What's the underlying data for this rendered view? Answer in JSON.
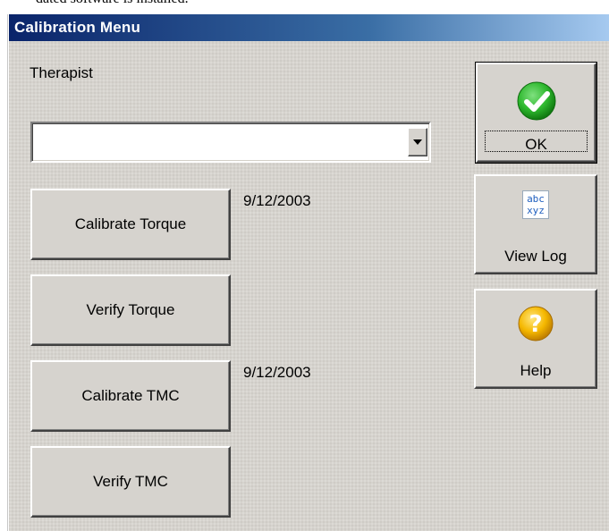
{
  "background_text": "dated software is installed.",
  "window": {
    "title": "Calibration Menu",
    "titlebar_gradient": [
      "#0a246a",
      "#a6caf0"
    ]
  },
  "therapist": {
    "label": "Therapist",
    "selected_value": ""
  },
  "actions": [
    {
      "label": "Calibrate Torque",
      "date": "9/12/2003"
    },
    {
      "label": "Verify Torque",
      "date": ""
    },
    {
      "label": "Calibrate TMC",
      "date": "9/12/2003"
    },
    {
      "label": "Verify TMC",
      "date": ""
    }
  ],
  "side_buttons": {
    "ok": {
      "label": "OK",
      "icon": "checkmark-icon",
      "icon_color": "#2eb82e"
    },
    "view_log": {
      "label": "View Log",
      "icon": "abc-xyz-icon",
      "icon_line1": "abc",
      "icon_line2": "xyz",
      "icon_color": "#1f5fbf"
    },
    "help": {
      "label": "Help",
      "icon": "question-icon",
      "icon_color": "#f5b800"
    }
  }
}
